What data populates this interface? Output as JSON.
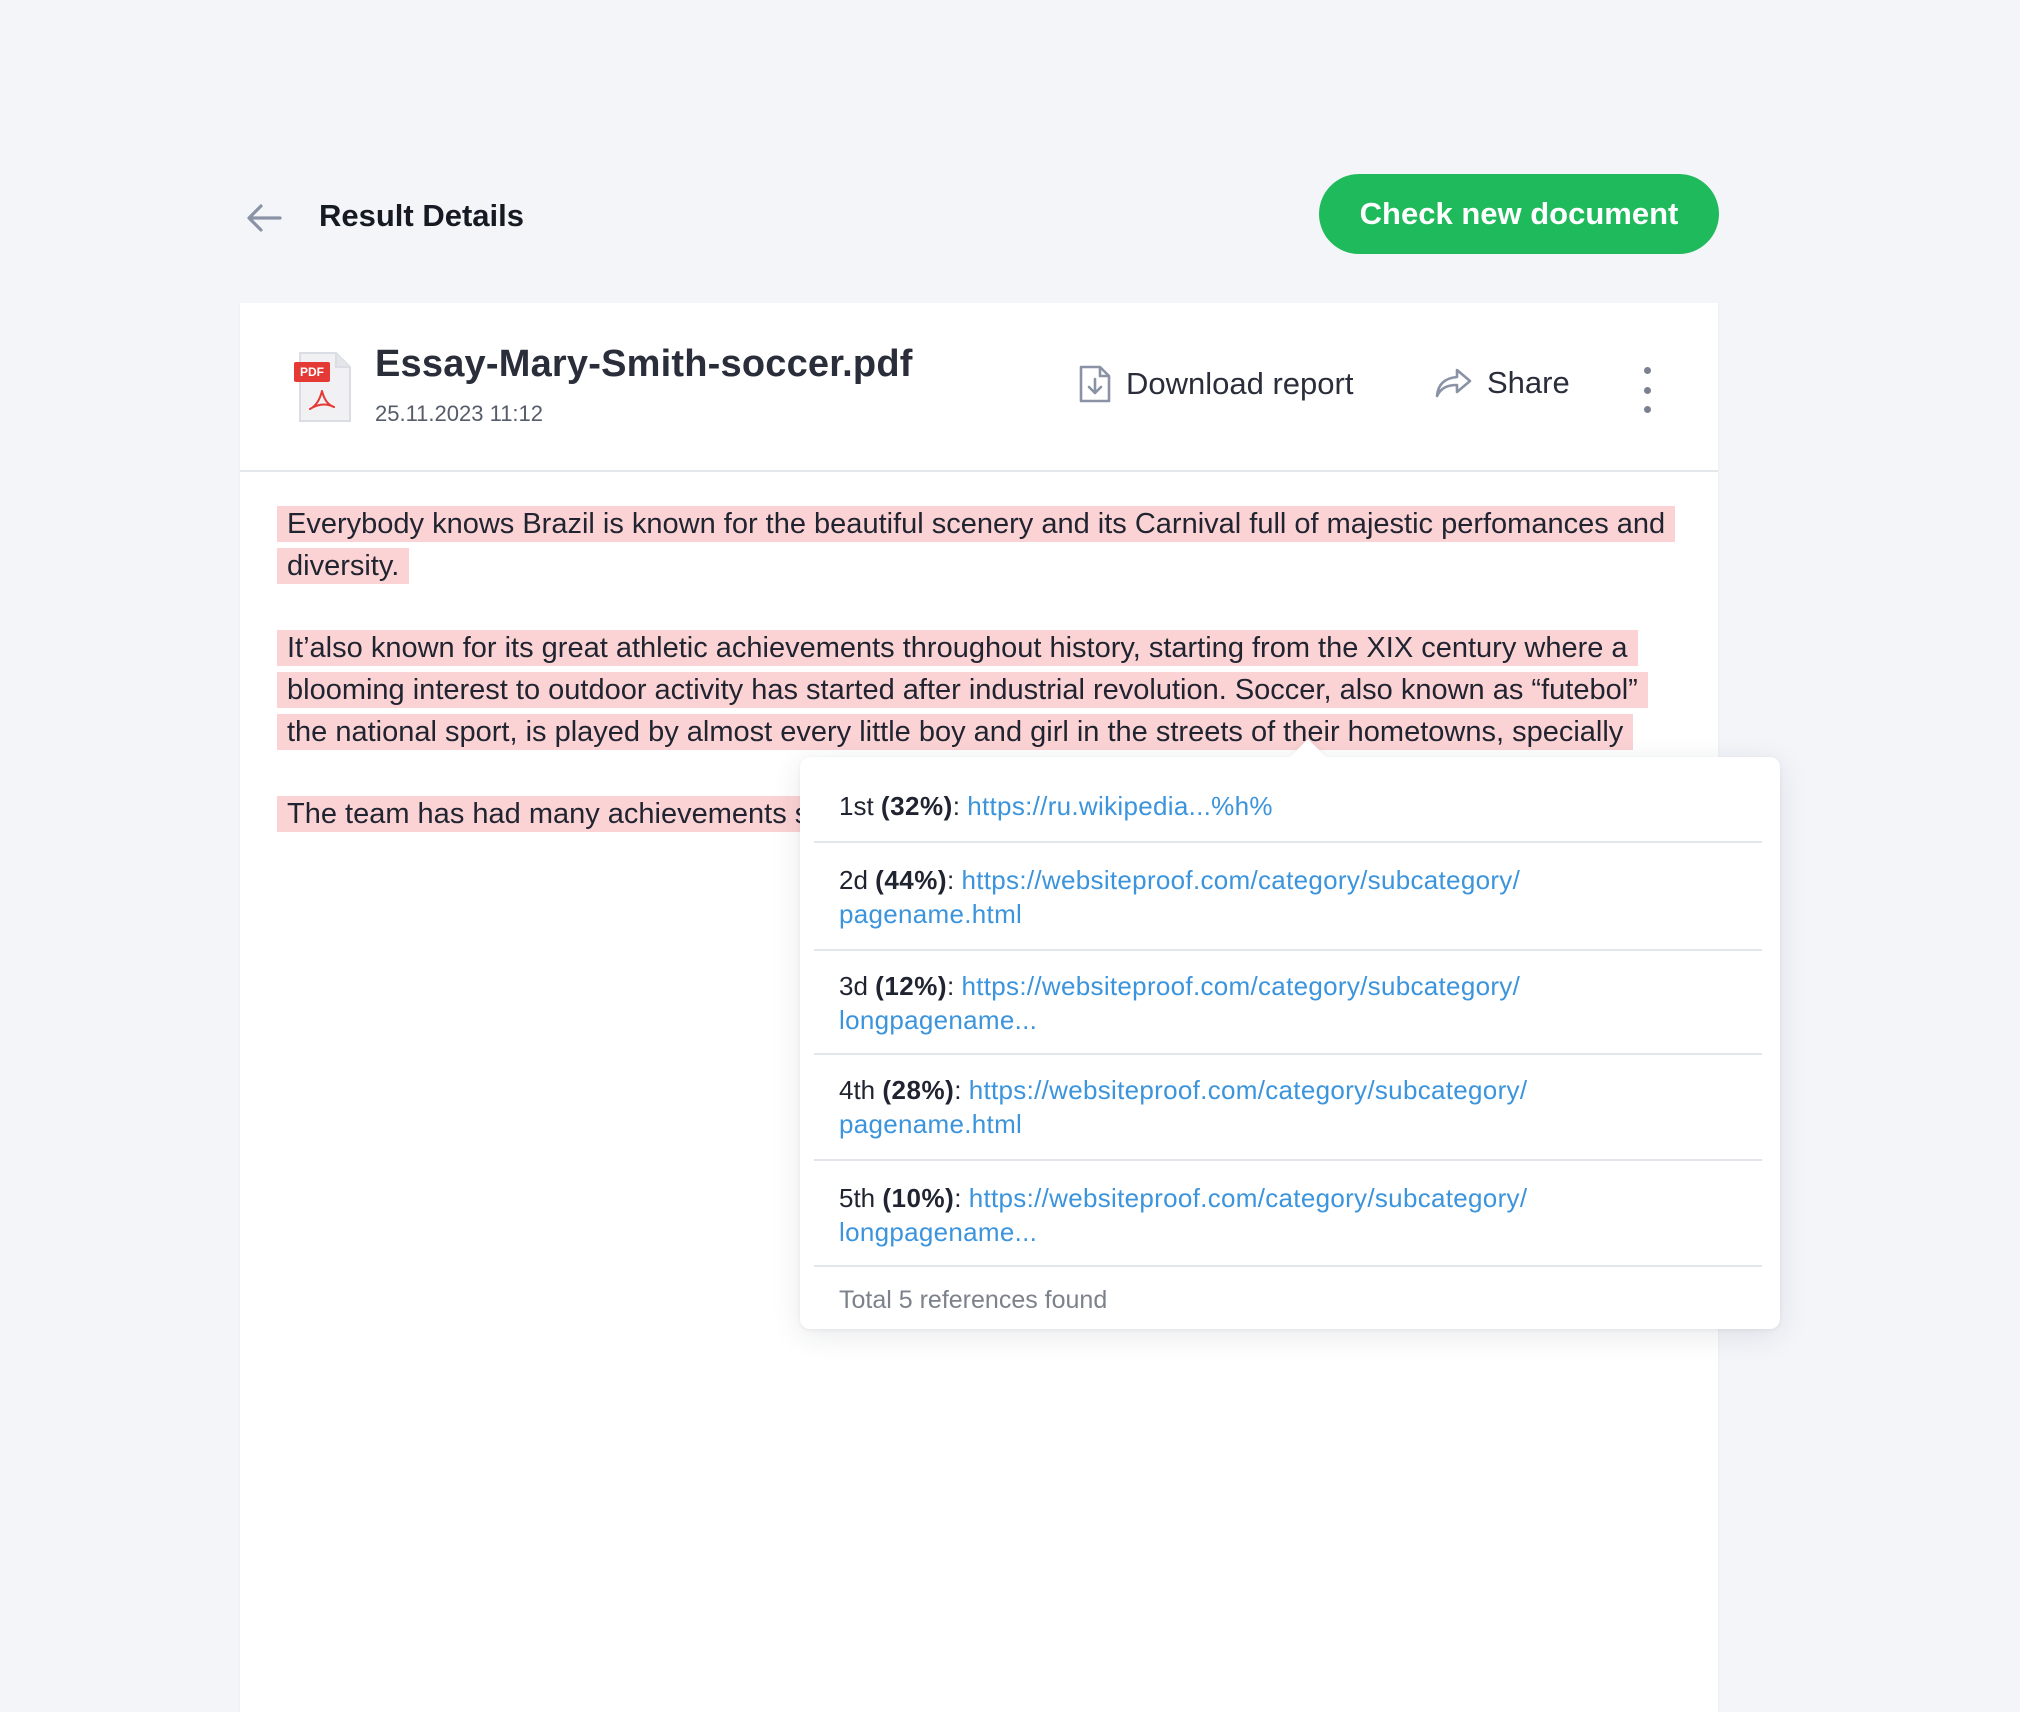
{
  "header": {
    "title": "Result Details",
    "check_button_label": "Check new document"
  },
  "document": {
    "file_name": "Essay-Mary-Smith-soccer.pdf",
    "file_badge": "PDF",
    "date": "25.11.2023 11:12",
    "download_label": "Download report",
    "share_label": "Share"
  },
  "paragraphs": [
    "Everybody knows Brazil is known for the beautiful scenery and its Carnival full of majestic perfomances and diversity.",
    "It’also known for its great athletic achievements throughout history, starting from the XIX century where a blooming interest to outdoor activity has started after industrial revolution. Soccer, also known as “futebol” the national sport, is played by almost every little boy and girl in the streets of their hometowns, specially",
    "The team has had many achievements since 1956."
  ],
  "references": [
    {
      "rank": "1st",
      "pct": "(32%)",
      "url": "https://ru.wikipedia...%h%",
      "url_line2": ""
    },
    {
      "rank": "2d",
      "pct": "(44%)",
      "url": "https://websiteproof.com/category/subcategory/",
      "url_line2": "pagename.html"
    },
    {
      "rank": "3d",
      "pct": "(12%)",
      "url": "https://websiteproof.com/category/subcategory/",
      "url_line2": "longpagename..."
    },
    {
      "rank": "4th",
      "pct": "(28%)",
      "url": "https://websiteproof.com/category/subcategory/",
      "url_line2": "pagename.html"
    },
    {
      "rank": "5th",
      "pct": "(10%)",
      "url": "https://websiteproof.com/category/subcategory/",
      "url_line2": "longpagename..."
    }
  ],
  "references_total": "Total 5 references found",
  "colors": {
    "accent_green": "#1fba5b",
    "highlight": "#fcd3d4",
    "link": "#3b94dc",
    "pdf_red": "#e53935"
  }
}
